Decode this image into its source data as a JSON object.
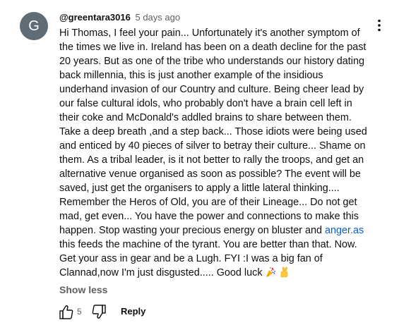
{
  "comment": {
    "avatar_initial": "G",
    "avatar_color": "#5f6b75",
    "author": "@greentara3016",
    "timestamp": "5 days ago",
    "menu_icon": "more-vert-icon",
    "lines": [
      "Hi Thomas, I feel your pain... Unfortunately it's another symptom of",
      "the times we live in. Ireland has been on a death decline for the past",
      "20 years. But as one of the tribe who understands our history dating",
      "back millennia, this is just another example of the insidious",
      "underhand invasion of our Country and culture. Being cheer lead by",
      "our false cultural idols, who probably don't have a brain cell left in",
      "their coke and McDonald's addled brains to share between them.",
      "Take a deep breath ,and a step back... Those idiots were being used",
      "and enticed by 40 pieces of silver to betray their culture... Shame on",
      "them. As a tribal leader, is it not better to rally the troops, and get an",
      "alternative venue organised as soon as possible? The event will be",
      "saved, just get the organisers to apply a little lateral thinking....",
      "Remember the Heros of Old, you are of their Lineage... Do not get",
      "mad, get even... You have the power and connections to make this"
    ],
    "line15_before_link": "happen. Stop wasting your precious energy on bluster and ",
    "link_text": "anger.as",
    "line16": "this feeds the machine of the tyrant. You are better than that. Now.",
    "line17": "Get your ass in gear and be a Lugh. FYI :I was a big fan of",
    "line18": "Clannad,now I'm just disgusted..... Good luck",
    "line18_emojis": [
      "party-popper-icon",
      "crossed-fingers-icon"
    ],
    "show_less_label": "Show less",
    "like_count": "5",
    "like_icon": "thumb-up-icon",
    "dislike_icon": "thumb-down-icon",
    "reply_label": "Reply",
    "link_color": "#065fd4"
  }
}
